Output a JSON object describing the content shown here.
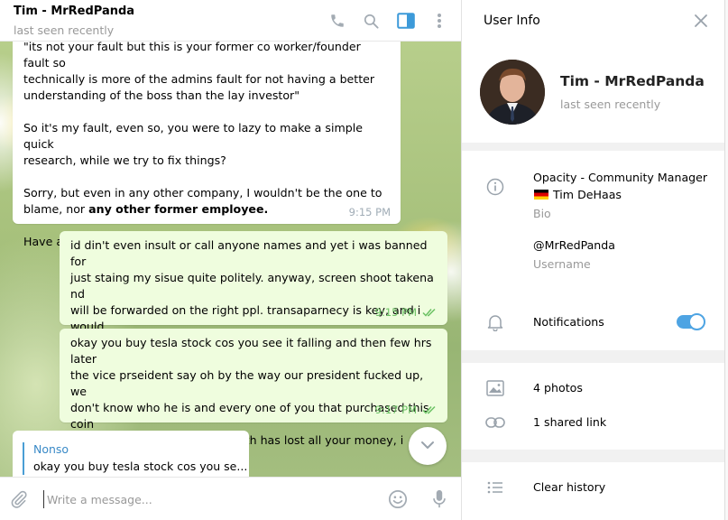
{
  "chat": {
    "title": "Tim - MrRedPanda",
    "status": "last seen recently",
    "messages": [
      {
        "text": "\"its not your fault but this is your former co worker/founder fault so\ntechnically is more of the admins fault for not having a better\nunderstanding of the boss than the lay investor\"\n\nSo it's my fault, even so, you were to lazy to make a simple quick\nresearch, while we try to fix things?\n\nSorry, but even in any other company, I wouldn't be the one to\nblame, nor ",
        "bold": "any other former employee.",
        "text_after": "\n\nHave a nice day, sir.",
        "time": "9:15 PM"
      },
      {
        "text": "id din't even insult or call anyone names and yet i was banned for\njust staing my sisue quite politely. anyway, screen shoot takena nd\nwill be forwarded on the right ppl. transaparnecy is key, and i would\nunderstand a ban if i was been insulting but i just stating my\nopinnion politely is not allowed.",
        "time": "9:15 PM"
      },
      {
        "text": "okay you buy tesla stock cos you see it falling and then few hrs later\nthe vice prseident say oh by the way our president fucked up, we\ndon't know who he is and every one of you that purchased this coin\nunder the value we dem it owrth has lost all your money, i guess\nnone of this tesla fault.",
        "time": "9:17 PM"
      }
    ],
    "reply": {
      "name": "Nonso",
      "text": "okay you buy tesla stock cos you se..."
    },
    "composer_placeholder": "Write a message..."
  },
  "info": {
    "title": "User Info",
    "name": "Tim - MrRedPanda",
    "status": "last seen recently",
    "bio_line1": "Opacity - Community Manager",
    "bio_line2": "Tim DeHaas",
    "bio_label": "Bio",
    "username": "@MrRedPanda",
    "username_label": "Username",
    "notifications_label": "Notifications",
    "notifications_on": true,
    "photos": "4 photos",
    "links": "1 shared link",
    "clear_history": "Clear history"
  },
  "colors": {
    "accent": "#4ea4e3",
    "out_bubble": "#effdde",
    "check": "#6cc264"
  }
}
